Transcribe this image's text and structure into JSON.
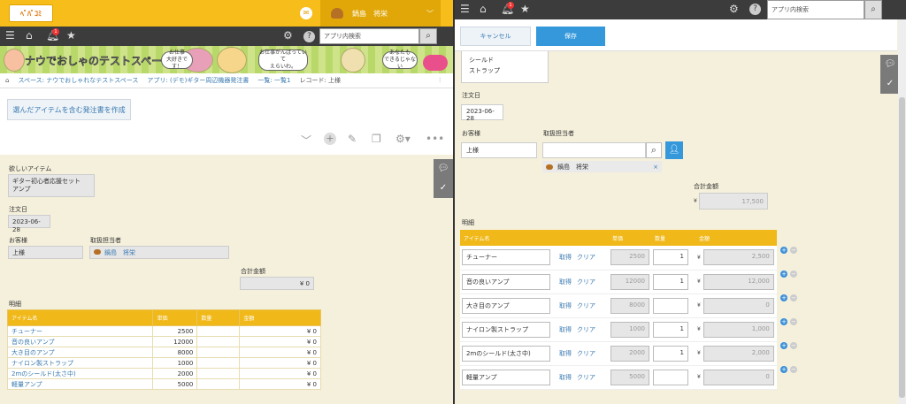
{
  "left": {
    "logo_text": "ﾍﾟﾊﾟｺﾐ",
    "user_name": "鍋島　将栄",
    "search_placeholder": "アプリ内検索",
    "notification_count": "1",
    "banner": {
      "title": "ナウでおしゃのテストスペース",
      "bubbles": [
        "お仕事\n大好きです！",
        "お仕事がんばっていて\nえらいわ。",
        "あなたも\nできるじゃない"
      ]
    },
    "breadcrumb": [
      "スペース: ナウでおしゃれなテストスペース",
      "アプリ: (デモ)ギター周辺機器発注書",
      "一覧: 一覧1",
      "レコード: 上様"
    ],
    "order_button": "選んだアイテムを含む発注書を作成",
    "fields": {
      "wanted_label": "欲しいアイテム",
      "wanted_values": [
        "ギター初心者応援セット",
        "アンプ"
      ],
      "date_label": "注文日",
      "date_value": "2023-06-28",
      "customer_label": "お客様",
      "customer_value": "上様",
      "staff_label": "取扱担当者",
      "staff_value": "鍋島　将栄",
      "total_label": "合計金額",
      "total_value": "¥ 0",
      "detail_label": "明細"
    },
    "table": {
      "headers": [
        "アイテム名",
        "単価",
        "数量",
        "金額"
      ],
      "rows": [
        {
          "name": "チューナー",
          "price": "2500",
          "qty": "",
          "amount": "¥ 0"
        },
        {
          "name": "音の良いアンプ",
          "price": "12000",
          "qty": "",
          "amount": "¥ 0"
        },
        {
          "name": "大き目のアンプ",
          "price": "8000",
          "qty": "",
          "amount": "¥ 0"
        },
        {
          "name": "ナイロン製ストラップ",
          "price": "1000",
          "qty": "",
          "amount": "¥ 0"
        },
        {
          "name": "2mのシールド(太さ中)",
          "price": "2000",
          "qty": "",
          "amount": "¥ 0"
        },
        {
          "name": "軽量アンプ",
          "price": "5000",
          "qty": "",
          "amount": "¥ 0"
        }
      ]
    }
  },
  "right": {
    "search_placeholder": "アプリ内検索",
    "notification_count": "1",
    "cancel_label": "キャンセル",
    "save_label": "保存",
    "wanted_values": [
      "シールド",
      "ストラップ"
    ],
    "date_label": "注文日",
    "date_value": "2023-06-28",
    "customer_label": "お客様",
    "customer_value": "上様",
    "staff_label": "取扱担当者",
    "staff_value": "鍋島　将栄",
    "staff_remove": "×",
    "total_label": "合計金額",
    "total_currency": "¥",
    "total_value": "17,500",
    "detail_label": "明細",
    "get_label": "取得",
    "clear_label": "クリア",
    "currency": "¥",
    "table": {
      "headers": [
        "アイテム名",
        "単価",
        "数量",
        "金額"
      ],
      "rows": [
        {
          "name": "チューナー",
          "price": "2500",
          "qty": "1",
          "amount": "2,500"
        },
        {
          "name": "音の良いアンプ",
          "price": "12000",
          "qty": "1",
          "amount": "12,000"
        },
        {
          "name": "大き目のアンプ",
          "price": "8000",
          "qty": "",
          "amount": "0"
        },
        {
          "name": "ナイロン製ストラップ",
          "price": "1000",
          "qty": "1",
          "amount": "1,000"
        },
        {
          "name": "2mのシールド(太さ中)",
          "price": "2000",
          "qty": "1",
          "amount": "2,000"
        },
        {
          "name": "軽量アンプ",
          "price": "5000",
          "qty": "",
          "amount": "0"
        }
      ]
    }
  },
  "colors": {
    "header_yellow": "#f7bd1a",
    "dark_bar": "#3c3c3c",
    "accent_blue": "#3498db",
    "form_bg": "#f5f0dc"
  },
  "icons": [
    "menu-icon",
    "home-icon",
    "bell-icon",
    "star-icon",
    "gear-icon",
    "help-icon",
    "search-icon",
    "chat-icon",
    "check-icon",
    "user-icon"
  ]
}
